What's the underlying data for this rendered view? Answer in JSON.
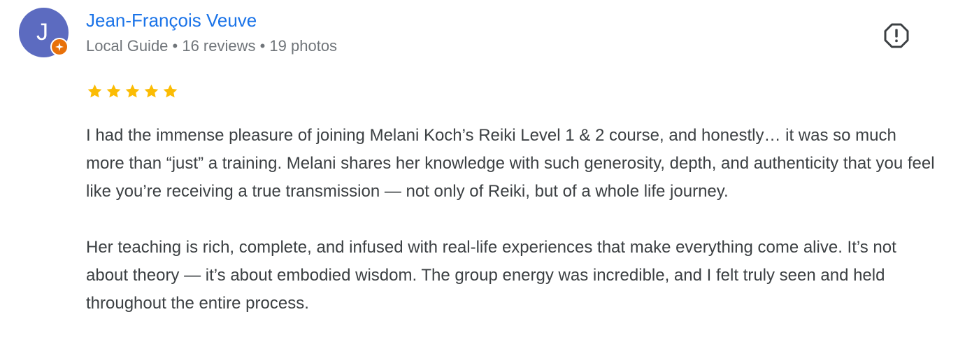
{
  "reviewer": {
    "initial": "J",
    "name": "Jean-François Veuve",
    "meta": "Local Guide • 16 reviews • 19 photos",
    "avatar_color": "#5c6bc0",
    "badge_color": "#e8710a"
  },
  "report": {
    "icon": "report-octagon-icon"
  },
  "rating": {
    "stars": 5,
    "max": 5,
    "color": "#fbbc04"
  },
  "review": {
    "paragraphs": [
      "I had the immense pleasure of joining Melani Koch’s Reiki Level 1 & 2 course, and honestly… it was so much more than “just” a training. Melani shares her knowledge with such generosity, depth, and authenticity that you feel like you’re receiving a true transmission — not only of Reiki, but of a whole life journey.",
      "Her teaching is rich, complete, and infused with real-life experiences that make everything come alive. It’s not about theory — it’s about embodied wisdom. The group energy was incredible, and I felt truly seen and held throughout the entire process."
    ]
  }
}
